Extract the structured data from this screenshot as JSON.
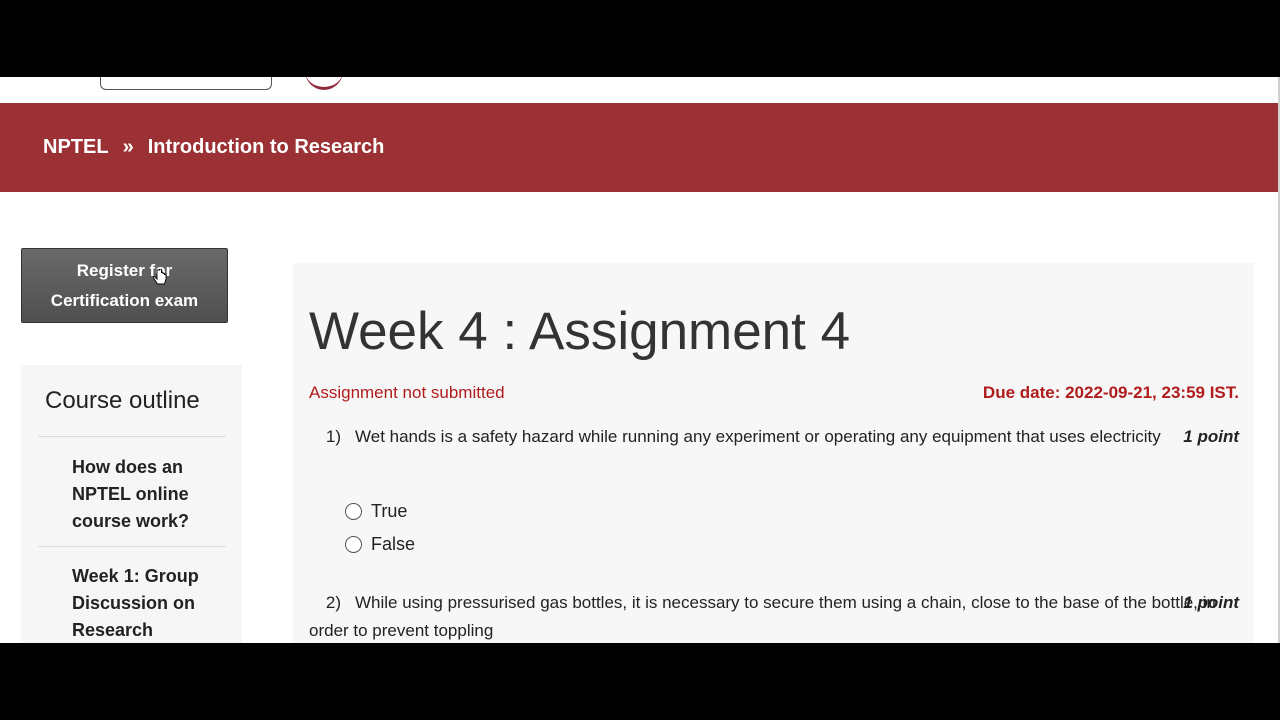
{
  "header": {
    "breadcrumb_home": "NPTEL",
    "breadcrumb_separator": "»",
    "breadcrumb_course": "Introduction to Research"
  },
  "sidebar": {
    "register_button": "Register for Certification exam",
    "outline_title": "Course outline",
    "items": [
      {
        "label": "How does an NPTEL online course work?"
      },
      {
        "label": "Week 1: Group Discussion on Research"
      }
    ]
  },
  "assignment": {
    "title": "Week 4 : Assignment 4",
    "status": "Assignment not submitted",
    "due_date": "Due date: 2022-09-21, 23:59 IST."
  },
  "questions": [
    {
      "number": "1)",
      "text": "Wet hands is a safety hazard while running any experiment or operating any equipment that uses electricity",
      "points": "1 point",
      "options": [
        "True",
        "False"
      ]
    },
    {
      "number": "2)",
      "text": "While using pressurised gas bottles, it is necessary to secure them using a chain, close to the base of the bottle, in order to prevent toppling",
      "points": "1 point"
    }
  ],
  "colors": {
    "banner": "#9b3134",
    "alert_red": "#b01c1c",
    "button_gray": "#5a5a5a"
  }
}
